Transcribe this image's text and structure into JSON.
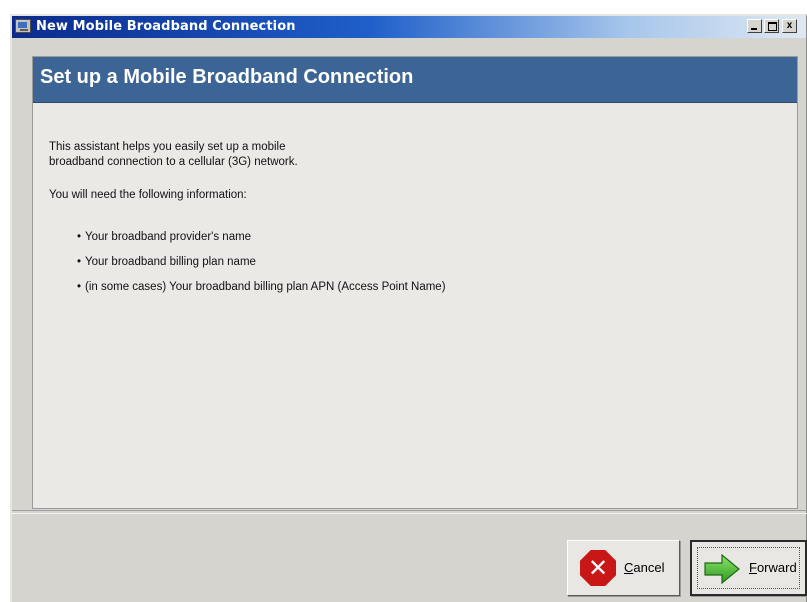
{
  "window": {
    "title": "New Mobile Broadband Connection"
  },
  "header": {
    "title": "Set up a Mobile Broadband Connection",
    "color": "#3c6494"
  },
  "body": {
    "intro_line1": "This assistant helps you easily set up a mobile",
    "intro_line2": "broadband connection to a cellular (3G) network.",
    "need_text": "You will need the following information:",
    "requirements": [
      "Your broadband provider's name",
      "Your broadband billing plan name",
      "(in some cases) Your broadband billing plan APN (Access Point Name)"
    ]
  },
  "buttons": {
    "cancel": {
      "accel": "C",
      "rest": "ancel",
      "icon": "stop-x-icon"
    },
    "forward": {
      "accel": "F",
      "rest": "orward",
      "icon": "green-arrow-icon"
    }
  },
  "window_controls": {
    "minimize_icon": "minimize-icon",
    "maximize_icon": "maximize-icon",
    "close_icon": "close-icon",
    "close_glyph": "x"
  },
  "bullet": "•"
}
